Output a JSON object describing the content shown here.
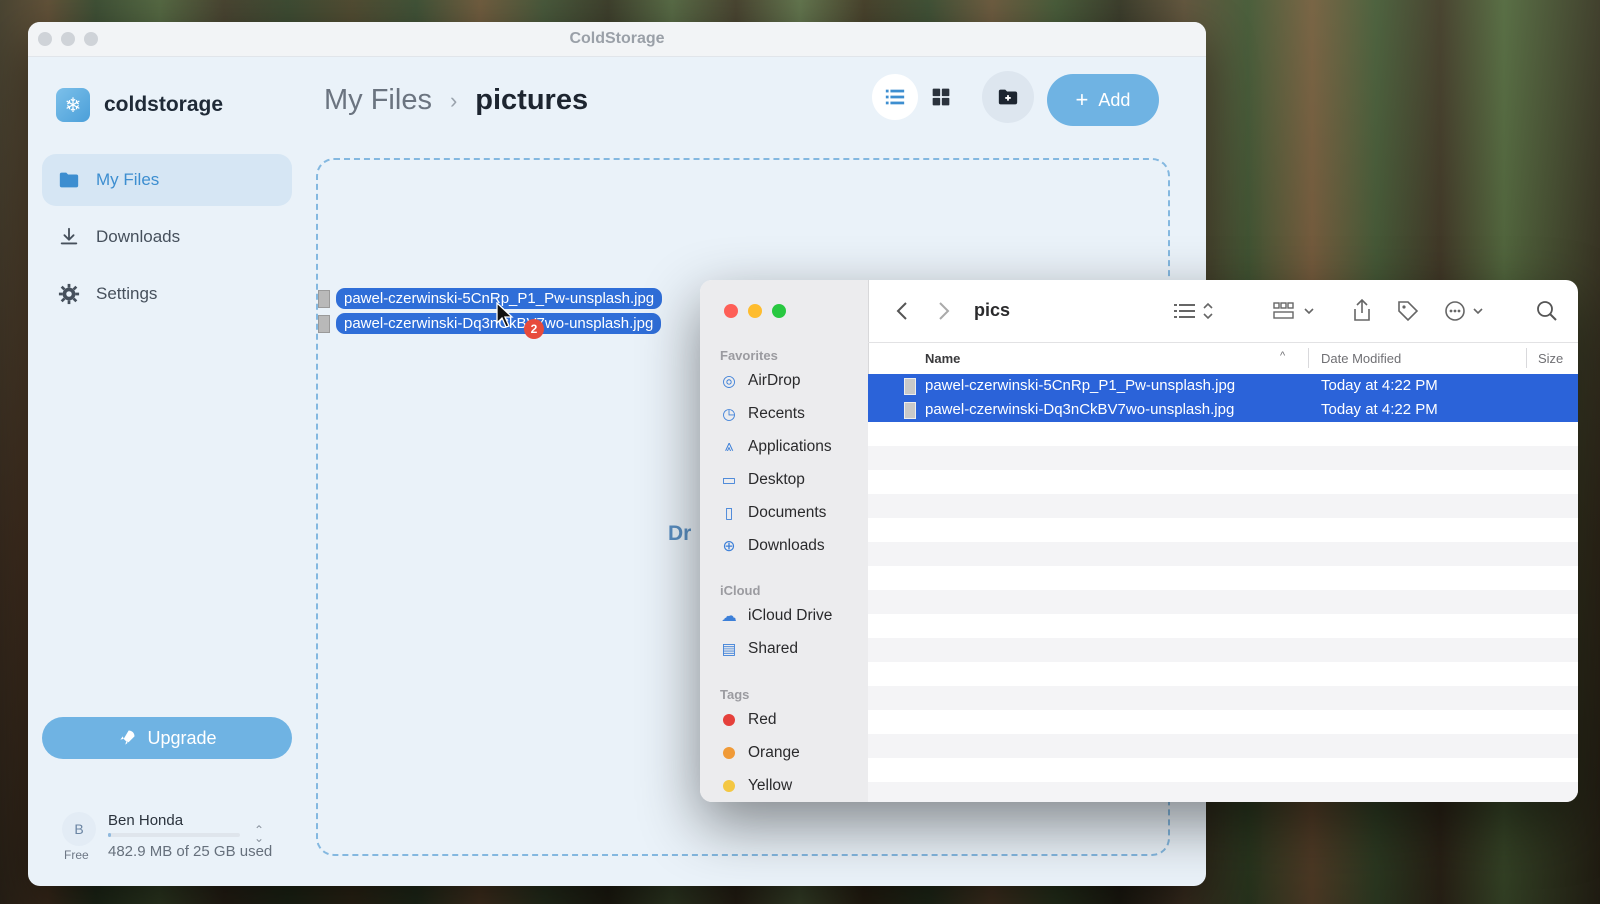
{
  "coldstorage": {
    "window_title": "ColdStorage",
    "brand": "coldstorage",
    "nav": [
      {
        "label": "My Files",
        "icon": "folder-icon",
        "active": true
      },
      {
        "label": "Downloads",
        "icon": "download-icon",
        "active": false
      },
      {
        "label": "Settings",
        "icon": "gear-icon",
        "active": false
      }
    ],
    "upgrade_label": "Upgrade",
    "user": {
      "initial": "B",
      "name": "Ben Honda",
      "plan": "Free",
      "usage_text": "482.9 MB of 25 GB used",
      "usage_fraction": 0.019
    },
    "breadcrumb": {
      "root": "My Files",
      "separator": "›",
      "current": "pictures"
    },
    "add_label": "Add",
    "drop_hint": "Dr",
    "drag": {
      "files": [
        "pawel-czerwinski-5CnRp_P1_Pw-unsplash.jpg",
        "pawel-czerwinski-Dq3nCkBV7wo-unsplash.jpg"
      ],
      "count": "2"
    },
    "colors": {
      "accent": "#6fb3e3",
      "active_nav_bg": "#d6e6f4",
      "selection": "#2f6ed8"
    }
  },
  "finder": {
    "folder_name": "pics",
    "sections": {
      "favorites": "Favorites",
      "icloud": "iCloud",
      "tags": "Tags"
    },
    "favorites": [
      "AirDrop",
      "Recents",
      "Applications",
      "Desktop",
      "Documents",
      "Downloads"
    ],
    "icloud": [
      "iCloud Drive",
      "Shared"
    ],
    "tags": [
      {
        "label": "Red",
        "color": "#e5403b"
      },
      {
        "label": "Orange",
        "color": "#f09a37"
      },
      {
        "label": "Yellow",
        "color": "#f4c742"
      }
    ],
    "columns": {
      "name": "Name",
      "date": "Date Modified",
      "size": "Size"
    },
    "files": [
      {
        "name": "pawel-czerwinski-5CnRp_P1_Pw-unsplash.jpg",
        "date": "Today at 4:22 PM"
      },
      {
        "name": "pawel-czerwinski-Dq3nCkBV7wo-unsplash.jpg",
        "date": "Today at 4:22 PM"
      }
    ]
  }
}
